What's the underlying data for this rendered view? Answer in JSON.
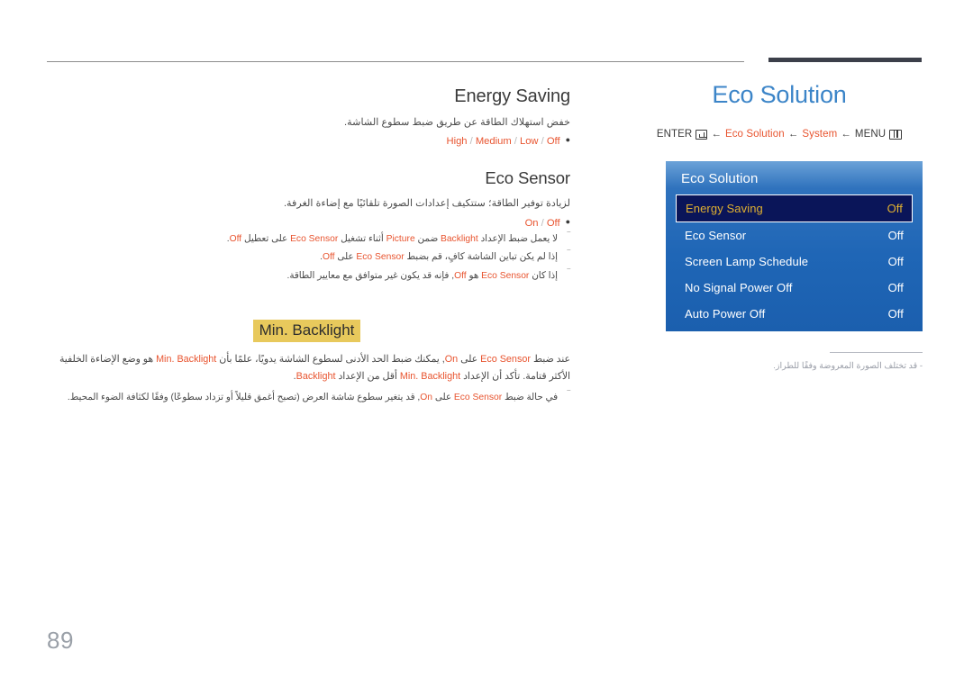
{
  "page": {
    "number": "89",
    "language": "ar"
  },
  "header": {
    "title": "Eco Solution",
    "breadcrumb": {
      "enter_label": "ENTER",
      "enter_icon": "enter-icon",
      "arrow": "←",
      "item_eco_solution": "Eco Solution",
      "item_system": "System",
      "item_menu": "MENU",
      "menu_icon": "menu-icon"
    }
  },
  "osd": {
    "title": "Eco Solution",
    "rows": [
      {
        "label": "Energy Saving",
        "value": "Off",
        "selected": true
      },
      {
        "label": "Eco Sensor",
        "value": "Off",
        "selected": false
      },
      {
        "label": "Screen Lamp Schedule",
        "value": "Off",
        "selected": false
      },
      {
        "label": "No Signal Power Off",
        "value": "Off",
        "selected": false
      },
      {
        "label": "Auto Power Off",
        "value": "Off",
        "selected": false
      }
    ],
    "note": "-  قد تختلف الصورة المعروضة وفقًا للطراز."
  },
  "sections": {
    "energy_saving": {
      "heading": "Energy Saving",
      "description": "خفض استهلاك الطاقة عن طريق ضبط سطوع الشاشة.",
      "options": [
        "High",
        "Medium",
        "Low",
        "Off"
      ]
    },
    "eco_sensor": {
      "heading": "Eco Sensor",
      "description": "لزيادة توفير الطاقة؛ ستتكيف إعدادات الصورة تلقائيًا مع إضاءة الغرفة.",
      "options": [
        "On",
        "Off"
      ],
      "notes": [
        {
          "parts": [
            {
              "t": "لا يعمل ضبط الإعداد ",
              "accent": false
            },
            {
              "t": "Backlight",
              "accent": true
            },
            {
              "t": " ضمن ",
              "accent": false
            },
            {
              "t": "Picture",
              "accent": true
            },
            {
              "t": " أثناء تشغيل ",
              "accent": false
            },
            {
              "t": "Eco Sensor",
              "accent": true
            },
            {
              "t": " على تعطيل ",
              "accent": false
            },
            {
              "t": "Off",
              "accent": true
            },
            {
              "t": ".",
              "accent": false
            }
          ]
        },
        {
          "parts": [
            {
              "t": "إذا لم يكن تباين الشاشة كافٍ، قم بضبط ",
              "accent": false
            },
            {
              "t": "Eco Sensor",
              "accent": true
            },
            {
              "t": " على ",
              "accent": false
            },
            {
              "t": "Off",
              "accent": true
            },
            {
              "t": ".",
              "accent": false
            }
          ]
        },
        {
          "parts": [
            {
              "t": "إذا كان ",
              "accent": false
            },
            {
              "t": "Eco Sensor",
              "accent": true
            },
            {
              "t": " هو ",
              "accent": false
            },
            {
              "t": "Off",
              "accent": true
            },
            {
              "t": ", فإنه قد يكون غير متوافق مع معايير الطاقة.",
              "accent": false
            }
          ]
        }
      ]
    },
    "min_backlight": {
      "heading": "Min. Backlight",
      "body_parts": [
        {
          "t": "عند ضبط ",
          "accent": false
        },
        {
          "t": "Eco Sensor",
          "accent": true
        },
        {
          "t": " على ",
          "accent": false
        },
        {
          "t": "On",
          "accent": true
        },
        {
          "t": ", يمكنك ضبط الحد الأدنى لسطوع الشاشة يدويًا، علمًا بأن ",
          "accent": false
        },
        {
          "t": "Min. Backlight",
          "accent": true
        },
        {
          "t": " هو وضع الإضاءة الخلفية الأكثر قتامة. تأكد أن الإعداد ",
          "accent": false
        },
        {
          "t": "Min. Backlight",
          "accent": true
        },
        {
          "t": " أقل من الإعداد ",
          "accent": false
        },
        {
          "t": "Backlight",
          "accent": true
        },
        {
          "t": ".",
          "accent": false
        }
      ],
      "note": {
        "parts": [
          {
            "t": "في حالة ضبط ",
            "accent": false
          },
          {
            "t": "Eco Sensor",
            "accent": true
          },
          {
            "t": " على ",
            "accent": false
          },
          {
            "t": "On",
            "accent": true
          },
          {
            "t": ", قد يتغير سطوع شاشة العرض (تصبح أغمق قليلاً أو تزداد سطوعًا) وفقًا لكثافة الضوء المحيط.",
            "accent": false
          }
        ]
      }
    }
  },
  "colors": {
    "accent_orange": "#e8542f",
    "title_blue": "#3c85c8",
    "highlight_yellow": "#e8c95c",
    "osd_blue": "#1f66b6",
    "osd_selected_bg": "#0a1559",
    "osd_selected_text": "#e0b030"
  }
}
